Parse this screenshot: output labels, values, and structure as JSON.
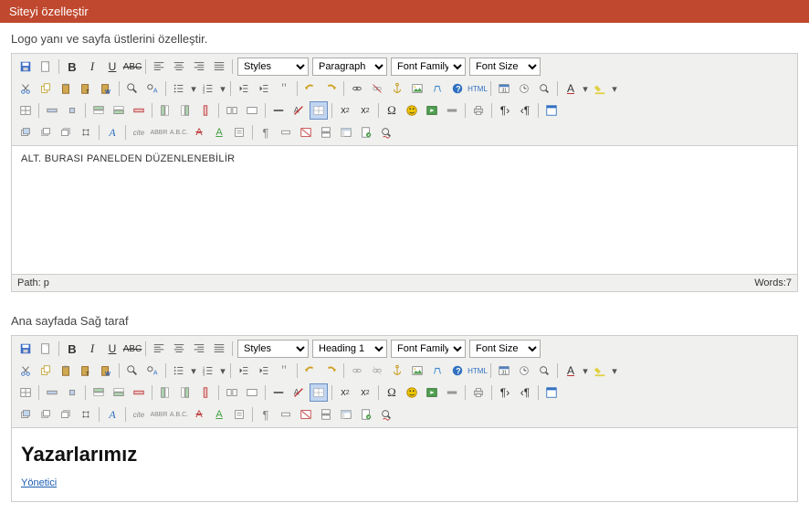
{
  "header": {
    "title": "Siteyi özelleştir"
  },
  "section1": {
    "title": "Logo yanı ve sayfa üstlerini özelleştir."
  },
  "section2": {
    "title": "Ana sayfada Sağ taraf"
  },
  "editor1": {
    "styles": "Styles",
    "paragraph": "Paragraph",
    "fontfamily": "Font Family",
    "fontsize": "Font Size",
    "content": "ALT. BURASI PANELDEN DÜZENLENEBİLİR",
    "path": "Path: p",
    "words": "Words:7"
  },
  "editor2": {
    "styles": "Styles",
    "paragraph": "Heading 1",
    "fontfamily": "Font Family",
    "fontsize": "Font Size",
    "heading": "Yazarlarımız",
    "link": "Yönetici"
  }
}
